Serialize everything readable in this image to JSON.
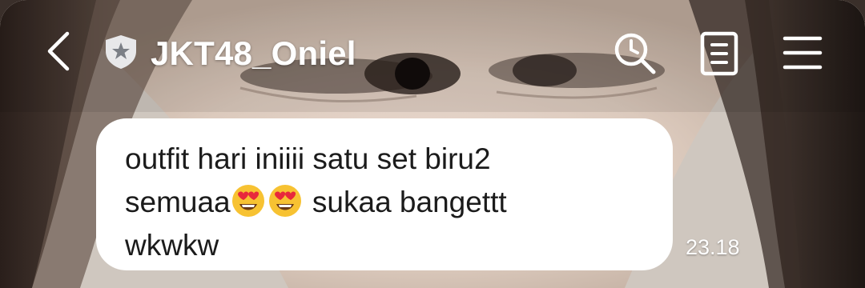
{
  "header": {
    "title": "JKT48_Oniel",
    "back_icon": "chevron-left-icon",
    "badge_icon": "shield-star-icon",
    "actions": [
      "search-icon",
      "notes-icon",
      "menu-icon"
    ]
  },
  "message": {
    "line1": "outfit hari iniiii satu set biru2",
    "line2_prefix": "semuaa",
    "line2_suffix": " sukaa bangettt",
    "line3": "wkwkw",
    "emoji": "smiling-face-with-heart-eyes",
    "emoji_count": 2,
    "time": "23.18"
  },
  "colors": {
    "bubble": "#ffffff",
    "text": "#1b1b1b",
    "header_text": "#ffffff"
  }
}
